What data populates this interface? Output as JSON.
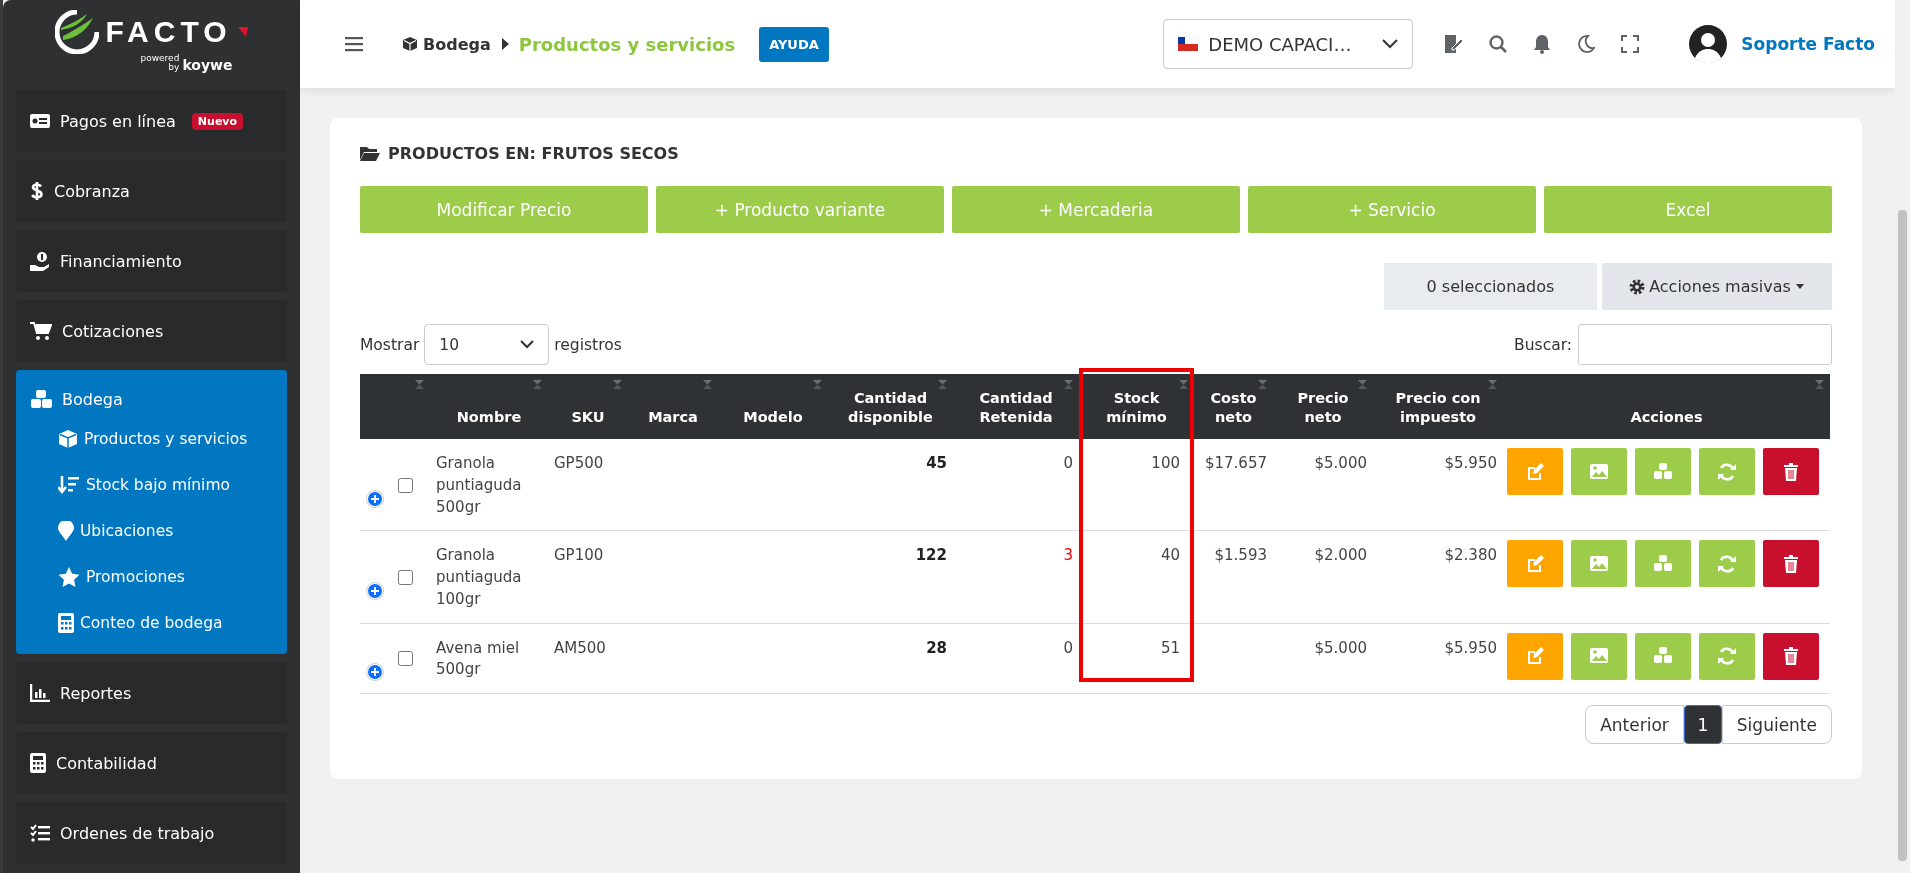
{
  "logo": {
    "brand": "FACTO",
    "powered": "powered",
    "by": "by",
    "partner": "koywe"
  },
  "sidebar": {
    "items": [
      {
        "kind": "payments",
        "label": "Pagos en línea",
        "badge": "Nuevo",
        "selected": false
      },
      {
        "kind": "collections",
        "label": "Cobranza",
        "selected": false
      },
      {
        "kind": "financing",
        "label": "Financiamiento",
        "selected": false
      },
      {
        "kind": "quotes",
        "label": "Cotizaciones",
        "selected": false
      },
      {
        "kind": "warehouse",
        "label": "Bodega",
        "selected": true,
        "expanded": true,
        "children": [
          {
            "kind": "products",
            "label": "Productos y servicios"
          },
          {
            "kind": "lowstock",
            "label": "Stock bajo mínimo"
          },
          {
            "kind": "locations",
            "label": "Ubicaciones"
          },
          {
            "kind": "promos",
            "label": "Promociones"
          },
          {
            "kind": "count",
            "label": "Conteo de bodega"
          }
        ]
      },
      {
        "kind": "reports",
        "label": "Reportes",
        "selected": false
      },
      {
        "kind": "accounting",
        "label": "Contabilidad",
        "selected": false
      },
      {
        "kind": "orders",
        "label": "Ordenes de trabajo",
        "selected": false
      }
    ]
  },
  "topbar": {
    "breadcrumb": [
      {
        "label": "Bodega",
        "current": false
      },
      {
        "label": "Productos y servicios",
        "current": true
      }
    ],
    "help": "AYUDA",
    "company": "DEMO CAPACI…",
    "user": "Soporte Facto"
  },
  "card": {
    "title": "PRODUCTOS EN: FRUTOS SECOS",
    "buttons": [
      "Modificar Precio",
      "+ Producto variante",
      "+ Mercaderia",
      "+ Servicio",
      "Excel"
    ],
    "selected_count": "0 seleccionados",
    "bulk_actions": "Acciones masivas",
    "show_label": "Mostrar",
    "page_size": "10",
    "records_label": "registros",
    "search_label": "Buscar:"
  },
  "table": {
    "columns": [
      {
        "sortable": true,
        "highlighted": false
      },
      {
        "label": "Nombre",
        "sortable": true,
        "highlighted": false
      },
      {
        "label": "SKU",
        "sortable": true,
        "highlighted": false
      },
      {
        "label": "Marca",
        "sortable": true,
        "highlighted": false
      },
      {
        "label": "Modelo",
        "sortable": true,
        "highlighted": false
      },
      {
        "label": "Cantidad disponible",
        "sortable": true,
        "highlighted": false
      },
      {
        "label": "Cantidad Retenida",
        "sortable": true,
        "highlighted": false
      },
      {
        "label": "Stock mínimo",
        "sortable": true,
        "highlighted": true
      },
      {
        "label": "Costo neto",
        "sortable": true,
        "highlighted": false
      },
      {
        "label": "Precio neto",
        "sortable": true,
        "highlighted": false
      },
      {
        "label": "Precio con impuesto",
        "sortable": true,
        "highlighted": false
      },
      {
        "label": "Acciones",
        "sortable": true,
        "highlighted": false
      }
    ],
    "rows": [
      {
        "checked": false,
        "name": "Granola puntiaguda 500gr",
        "sku": "GP500",
        "available": "45",
        "retained": "0",
        "retained_alert": false,
        "min_stock": "100",
        "net_cost": "$17.657",
        "net_price": "$5.000",
        "price_tax": "$5.950"
      },
      {
        "checked": false,
        "name": "Granola puntiaguda 100gr",
        "sku": "GP100",
        "available": "122",
        "retained": "3",
        "retained_alert": true,
        "min_stock": "40",
        "net_cost": "$1.593",
        "net_price": "$2.000",
        "price_tax": "$2.380"
      },
      {
        "checked": false,
        "name": "Avena miel 500gr",
        "sku": "AM500",
        "available": "28",
        "retained": "0",
        "retained_alert": false,
        "min_stock": "51",
        "net_price": "$5.000",
        "price_tax": "$5.950"
      }
    ]
  },
  "pagination": {
    "prev": "Anterior",
    "pages": [
      {
        "label": "1",
        "selected": true
      }
    ],
    "next": "Siguiente"
  }
}
